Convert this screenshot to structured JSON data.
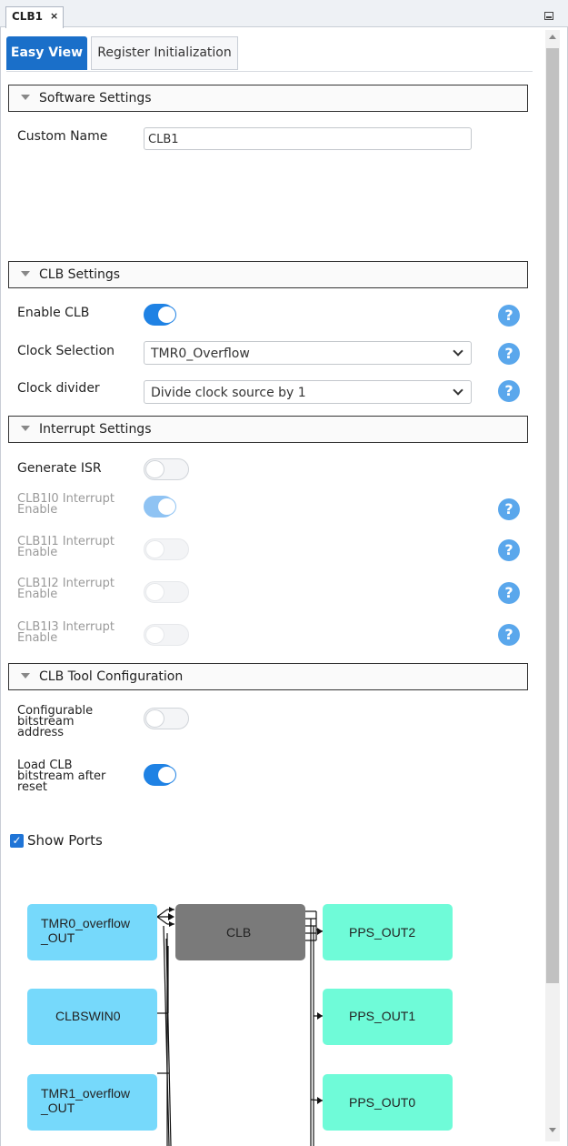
{
  "window": {
    "tab_label": "CLB1",
    "tab_close": "×"
  },
  "view_tabs": [
    {
      "label": "Easy View",
      "active": true
    },
    {
      "label": "Register Initialization",
      "active": false
    }
  ],
  "software_settings": {
    "header": "Software Settings",
    "custom_name_label": "Custom Name",
    "custom_name_value": "CLB1"
  },
  "clb_settings": {
    "header": "CLB Settings",
    "enable_clb_label": "Enable CLB",
    "enable_clb_on": true,
    "clock_selection_label": "Clock Selection",
    "clock_selection_value": "TMR0_Overflow",
    "clock_divider_label": "Clock divider",
    "clock_divider_value": "Divide clock source by 1"
  },
  "interrupt_settings": {
    "header": "Interrupt Settings",
    "generate_isr_label": "Generate ISR",
    "generate_isr_on": false,
    "interrupts": [
      {
        "line1": "CLB1I0 Interrupt",
        "line2": "Enable",
        "on": true,
        "disabled": true
      },
      {
        "line1": "CLB1I1 Interrupt",
        "line2": "Enable",
        "on": false,
        "disabled": true
      },
      {
        "line1": "CLB1I2 Interrupt",
        "line2": "Enable",
        "on": false,
        "disabled": true
      },
      {
        "line1": "CLB1I3 Interrupt",
        "line2": "Enable",
        "on": false,
        "disabled": true
      }
    ]
  },
  "tool_configuration": {
    "header": "CLB Tool Configuration",
    "configurable_address": {
      "line1": "Configurable",
      "line2": "bitstream",
      "line3": "address",
      "on": false
    },
    "load_after_reset": {
      "line1": "Load CLB",
      "line2": "bitstream after",
      "line3": "reset",
      "on": true
    }
  },
  "show_ports": {
    "label": "Show Ports",
    "checked": true
  },
  "help_glyph": "?",
  "diagram": {
    "inputs": [
      {
        "line1": "TMR0_overflow",
        "line2": "_OUT"
      },
      {
        "line1": "CLBSWIN0",
        "line2": ""
      },
      {
        "line1": "TMR1_overflow",
        "line2": "_OUT"
      }
    ],
    "core": "CLB",
    "outputs": [
      "PPS_OUT2",
      "PPS_OUT1",
      "PPS_OUT0"
    ]
  },
  "colors": {
    "accent": "#1a6fc9",
    "toggle_on": "#1f82e4",
    "help": "#5aa7ec",
    "input_block": "#76d9fb",
    "output_block": "#6ffbd8",
    "core_block": "#7a7a7a"
  }
}
